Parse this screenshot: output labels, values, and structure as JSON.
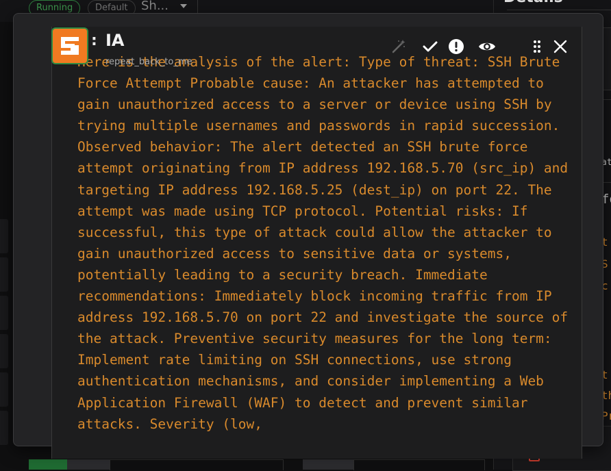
{
  "background": {
    "status_pill": "Running",
    "default_pill": "Default",
    "dropdown_text": "Sh...",
    "right_panel_title": "Details",
    "right_text_fragments": [
      "at",
      "fo",
      "t",
      "S",
      "c",
      "t",
      "th",
      "Pr"
    ]
  },
  "modal": {
    "title": "IA",
    "subtitle": "repeat_back_to_me",
    "colon": ":",
    "analysis_text": "Here is the analysis of the alert: Type of threat: SSH Brute Force Attempt Probable cause: An attacker has attempted to gain unauthorized access to a server or device using SSH by trying multiple usernames and passwords in rapid succession. Observed behavior: The alert detected an SSH brute force attempt originating from IP address 192.168.5.70 (src_ip) and targeting IP address 192.168.5.25 (dest_ip) on port 22. The attempt was made using TCP protocol. Potential risks: If successful, this type of attack could allow the attacker to gain unauthorized access to sensitive data or systems, potentially leading to a security breach. Immediate recommendations: Immediately block incoming traffic from IP address 192.168.5.70 on port 22 and investigate the source of the attack. Preventive security measures for the long term: Implement rate limiting on SSH connections, use strong authentication mechanisms, and consider implementing a Web Application Firewall (WAF) to detect and prevent similar attacks. Severity (low,",
    "toolbar": [
      "magic-wand-icon",
      "check-icon",
      "alert-icon",
      "eye-icon",
      "drag-handle-icon",
      "close-icon"
    ]
  },
  "colors": {
    "accent_orange": "#f07a21",
    "analysis_text": "#d98a2c",
    "running_green": "#2d7d3d"
  }
}
